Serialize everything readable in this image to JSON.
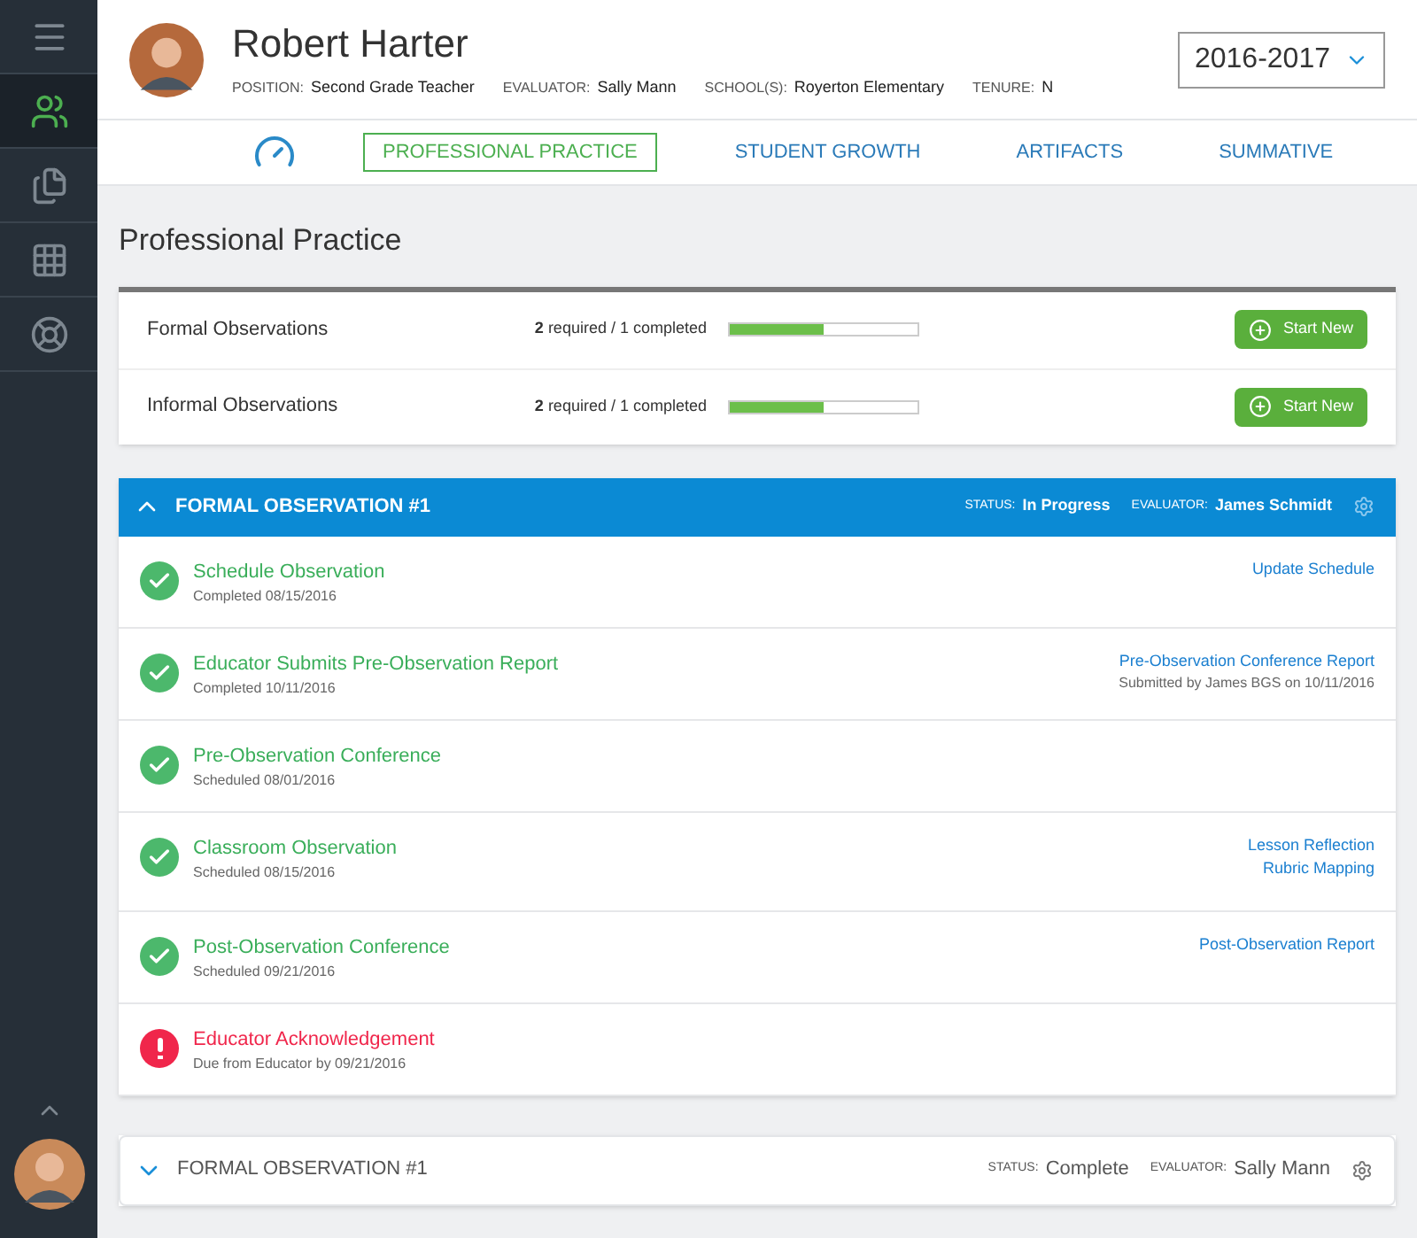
{
  "sidebar": {
    "items": [
      {
        "kind": "menu",
        "selected": false
      },
      {
        "kind": "people",
        "selected": true
      },
      {
        "kind": "documents",
        "selected": false
      },
      {
        "kind": "grid",
        "selected": false
      },
      {
        "kind": "lifebuoy",
        "selected": false
      }
    ]
  },
  "header": {
    "name": "Robert Harter",
    "fields": [
      {
        "label": "POSITION:",
        "value": "Second Grade Teacher"
      },
      {
        "label": "EVALUATOR:",
        "value": "Sally Mann"
      },
      {
        "label": "SCHOOL(S):",
        "value": "Royerton Elementary"
      },
      {
        "label": "TENURE:",
        "value": "N"
      }
    ],
    "year": "2016-2017"
  },
  "tabs": [
    {
      "kind": "icon",
      "selected": false
    },
    {
      "kind": "text",
      "label": "PROFESSIONAL PRACTICE",
      "selected": true
    },
    {
      "kind": "text",
      "label": "STUDENT GROWTH",
      "selected": false
    },
    {
      "kind": "text",
      "label": "ARTIFACTS",
      "selected": false
    },
    {
      "kind": "text",
      "label": "SUMMATIVE",
      "selected": false
    }
  ],
  "page_title": "Professional Practice",
  "observation_types": [
    {
      "name": "Formal Observations",
      "progress": "**2** required / 1 completed",
      "level": 0.5,
      "button": "Start New"
    },
    {
      "name": "Informal Observations",
      "progress": "**2** required / 1 completed",
      "level": 0.5,
      "button": "Start New"
    }
  ],
  "observations": [
    {
      "title": "FORMAL OBSERVATION #1",
      "expanded": true,
      "status_label": "STATUS:",
      "status": "In Progress",
      "evaluator_label": "EVALUATOR:",
      "evaluator": "James Schmidt",
      "steps": [
        {
          "title": "Schedule Observation",
          "subtitle": "Completed 08/15/2016",
          "kind": "done",
          "links": [
            "Update Schedule"
          ]
        },
        {
          "title": "Educator Submits Pre-Observation Report",
          "subtitle": "Completed 10/11/2016",
          "kind": "done",
          "links": [
            "Pre-Observation Conference Report"
          ],
          "note": "Submitted by James BGS on 10/11/2016"
        },
        {
          "title": "Pre-Observation Conference",
          "subtitle": "Scheduled 08/01/2016",
          "kind": "done"
        },
        {
          "title": "Classroom Observation",
          "subtitle": "Scheduled 08/15/2016",
          "kind": "done",
          "links": [
            "Lesson Reflection",
            "Rubric Mapping"
          ]
        },
        {
          "title": "Post-Observation Conference",
          "subtitle": "Scheduled 09/21/2016",
          "kind": "done",
          "links": [
            "Post-Observation Report"
          ]
        },
        {
          "title": "Educator Acknowledgement",
          "subtitle": "Due from Educator by 09/21/2016",
          "kind": "due"
        }
      ]
    },
    {
      "title": "FORMAL OBSERVATION #1",
      "expanded": false,
      "status_label": "STATUS:",
      "status": "Complete",
      "evaluator_label": "EVALUATOR:",
      "evaluator": "Sally Mann"
    }
  ]
}
